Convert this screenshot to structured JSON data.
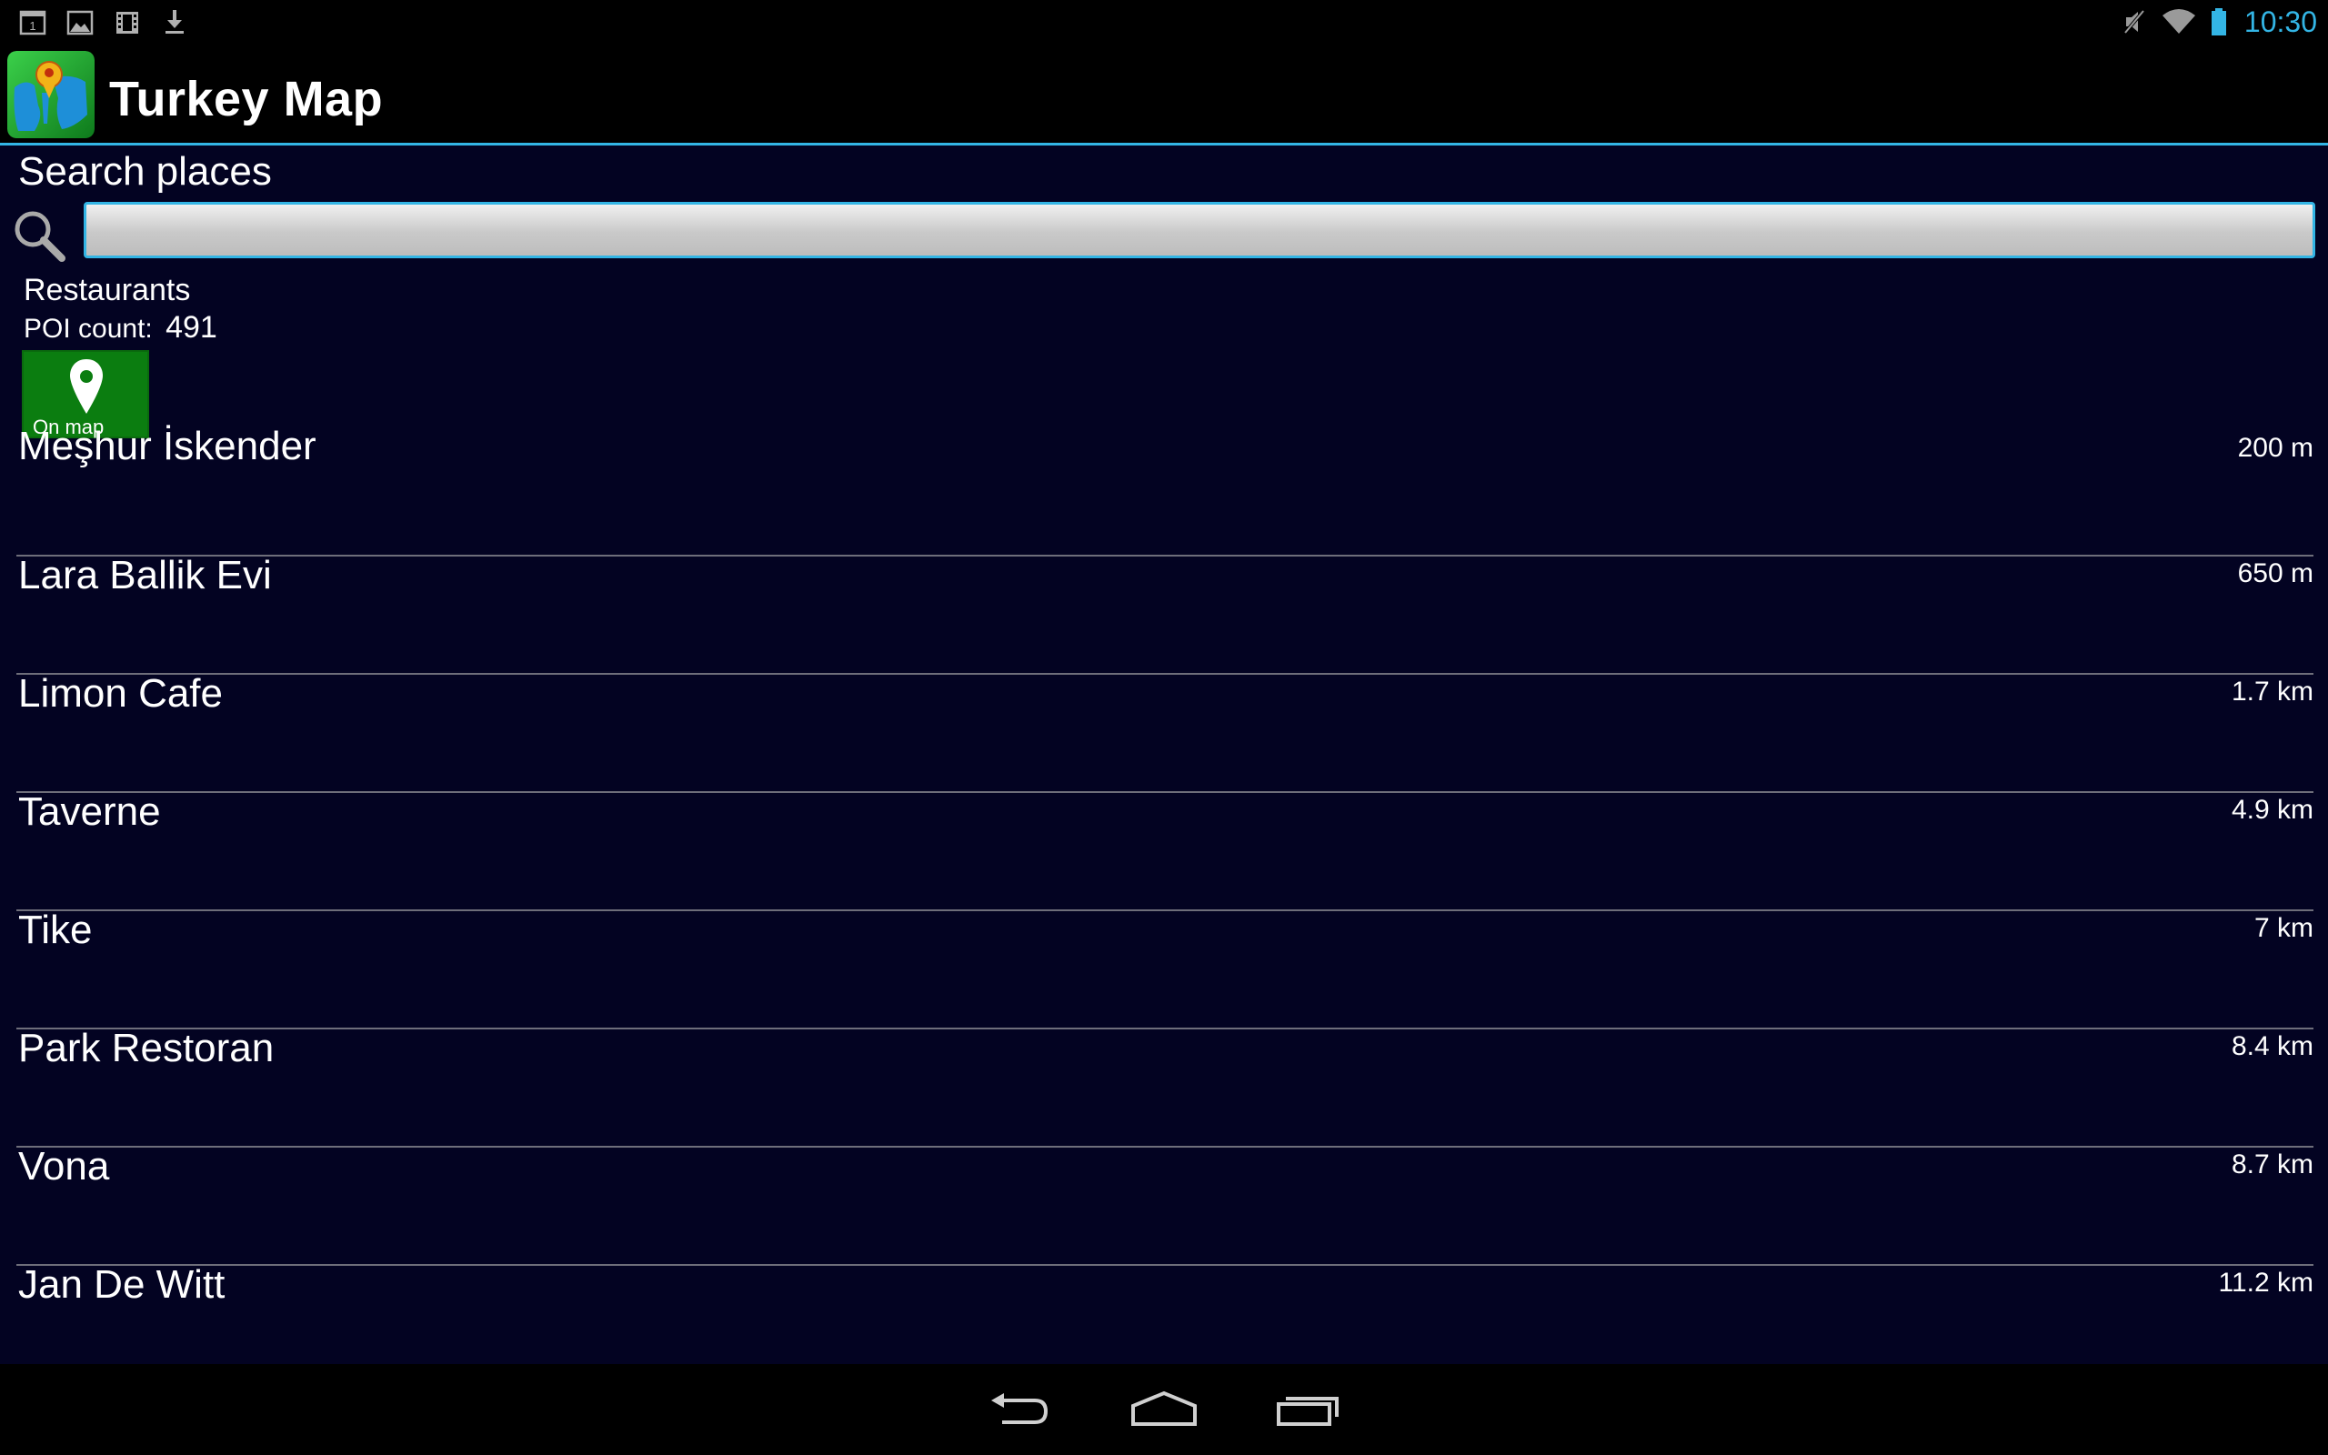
{
  "status_bar": {
    "left_icons": [
      "calendar-notification-icon",
      "image-notification-icon",
      "video-notification-icon",
      "download-notification-icon"
    ],
    "right_icons": [
      "mute-icon",
      "wifi-icon",
      "battery-icon"
    ],
    "time": "10:30"
  },
  "action_bar": {
    "app_icon": "turkey-map-app-icon",
    "title": "Turkey Map"
  },
  "search": {
    "label": "Search places",
    "value": "",
    "placeholder": ""
  },
  "category": {
    "name": "Restaurants",
    "poi_label": "POI count:",
    "poi_count": "491"
  },
  "on_map_button": {
    "label": "On map",
    "icon": "map-pin-icon"
  },
  "places": [
    {
      "name": "Meşhur İskender",
      "distance": "200 m"
    },
    {
      "name": "Lara Ballik Evi",
      "distance": "650 m"
    },
    {
      "name": "Limon Cafe",
      "distance": "1.7 km"
    },
    {
      "name": "Taverne",
      "distance": "4.9 km"
    },
    {
      "name": "Tike",
      "distance": "7 km"
    },
    {
      "name": "Park Restoran",
      "distance": "8.4 km"
    },
    {
      "name": "Vona",
      "distance": "8.7 km"
    },
    {
      "name": "Jan De Witt",
      "distance": "11.2 km"
    }
  ],
  "nav_bar": {
    "buttons": [
      "back-icon",
      "home-icon",
      "recent-apps-icon"
    ]
  },
  "colors": {
    "accent": "#33b5e5",
    "background": "#030322",
    "on_map_green": "#0b7d10"
  }
}
